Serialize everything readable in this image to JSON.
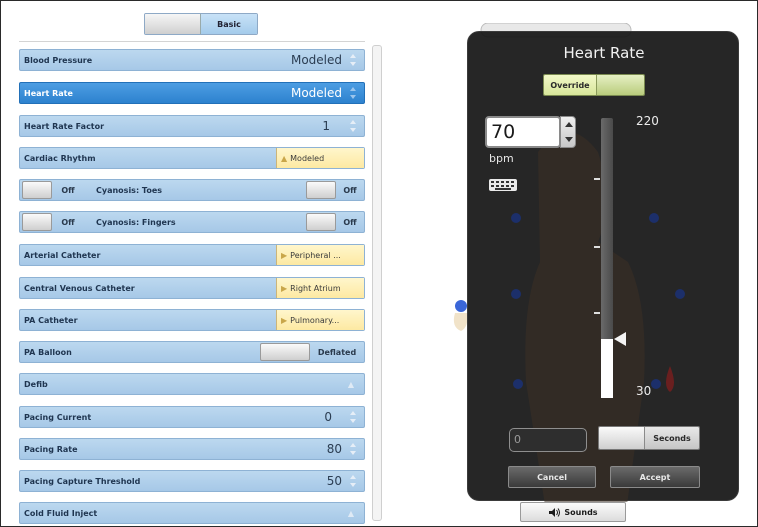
{
  "top_toggle": {
    "label": "Basic"
  },
  "parameters": [
    {
      "name": "Blood Pressure",
      "value": "Modeled",
      "kind": "spinner"
    },
    {
      "name": "Heart Rate",
      "value": "Modeled",
      "kind": "spinner",
      "selected": true
    },
    {
      "name": "Heart Rate Factor",
      "value": "1",
      "kind": "spinner"
    },
    {
      "name": "Cardiac Rhythm",
      "value": "Modeled",
      "kind": "select-up"
    },
    {
      "name": "Cyanosis: Toes",
      "left_value": "Off",
      "right_value": "Off",
      "kind": "toggle-pair"
    },
    {
      "name": "Cyanosis: Fingers",
      "left_value": "Off",
      "right_value": "Off",
      "kind": "toggle-pair"
    },
    {
      "name": "Arterial Catheter",
      "value": "Peripheral ...",
      "kind": "select-right"
    },
    {
      "name": "Central Venous Catheter",
      "value": "Right Atrium",
      "kind": "select-right"
    },
    {
      "name": "PA Catheter",
      "value": "Pulmonary...",
      "kind": "select-right"
    },
    {
      "name": "PA Balloon",
      "value": "Deflated",
      "kind": "toggle"
    },
    {
      "name": "Defib",
      "value": "",
      "kind": "expand"
    },
    {
      "name": "Pacing Current",
      "value": "0",
      "kind": "spinner"
    },
    {
      "name": "Pacing Rate",
      "value": "80",
      "kind": "spinner"
    },
    {
      "name": "Pacing Capture Threshold",
      "value": "50",
      "kind": "spinner"
    },
    {
      "name": "Cold Fluid Inject",
      "value": "",
      "kind": "expand"
    }
  ],
  "heart_rate_dialog": {
    "title": "Heart Rate",
    "override_label": "Override",
    "value": "70",
    "unit": "bpm",
    "slider_max": "220",
    "slider_min": "30",
    "slider_level": 0.21,
    "seconds_value": "0",
    "seconds_label": "Seconds",
    "cancel_label": "Cancel",
    "accept_label": "Accept"
  },
  "sounds_button": {
    "label": "Sounds"
  },
  "colors": {
    "row_blue": "#a6c8e7",
    "row_selected": "#2d82cf",
    "dialog_bg": "#161616",
    "override_green": "#d7e69a",
    "select_yellow": "#fde9a2"
  },
  "icons": [
    "spinner-arrows-icon",
    "keyboard-icon",
    "speaker-icon",
    "triangle-right-icon",
    "triangle-up-icon"
  ]
}
